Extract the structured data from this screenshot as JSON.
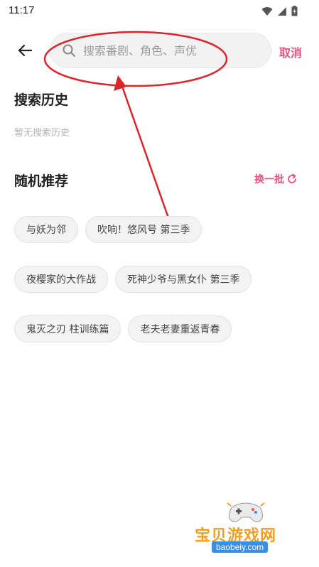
{
  "status_bar": {
    "time": "11:17",
    "icons": [
      "wifi-icon",
      "signal-icon",
      "battery-icon"
    ]
  },
  "header": {
    "back_icon": "arrow-left-icon",
    "search": {
      "placeholder": "搜索番剧、角色、声优",
      "value": ""
    },
    "cancel_label": "取消"
  },
  "history": {
    "title": "搜索历史",
    "empty_text": "暂无搜索历史"
  },
  "recommend": {
    "title": "随机推荐",
    "refresh_label": "换一批",
    "tags": [
      "与妖为邻",
      "吹响！悠风号 第三季",
      "夜樱家的大作战",
      "死神少爷与黑女仆 第三季",
      "鬼灭之刃 柱训练篇",
      "老夫老妻重返青春"
    ]
  },
  "watermark": {
    "title": "宝贝游戏网",
    "url": "baobeiy.com"
  },
  "colors": {
    "accent": "#e5517f",
    "annotation": "#d9262c",
    "tag_bg": "#f3f3f3",
    "placeholder": "#9b9b9b"
  }
}
